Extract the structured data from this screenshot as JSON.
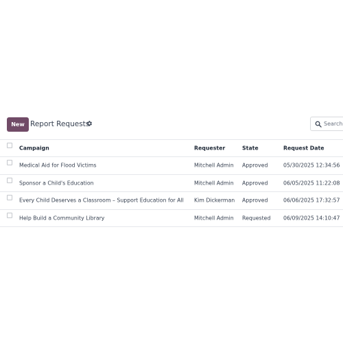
{
  "control_panel": {
    "new_label": "New",
    "title": "Report Requests",
    "search_placeholder": "Search"
  },
  "icons": {
    "gear": "gear-icon",
    "search": "search-icon"
  },
  "colors": {
    "primary": "#714b67"
  },
  "table": {
    "columns": [
      "Campaign",
      "Requester",
      "State",
      "Request Date"
    ],
    "rows": [
      {
        "campaign": "Medical Aid for Flood Victims",
        "requester": "Mitchell Admin",
        "state": "Approved",
        "date": "05/30/2025 12:34:56"
      },
      {
        "campaign": "Sponsor a Child's Education",
        "requester": "Mitchell Admin",
        "state": "Approved",
        "date": "06/05/2025 11:22:08"
      },
      {
        "campaign": "Every Child Deserves a Classroom – Support Education for All",
        "requester": "Kim Dickerman",
        "state": "Approved",
        "date": "06/06/2025 17:32:57"
      },
      {
        "campaign": "Help Build a Community Library",
        "requester": "Mitchell Admin",
        "state": "Requested",
        "date": "06/09/2025 14:10:47"
      }
    ]
  }
}
